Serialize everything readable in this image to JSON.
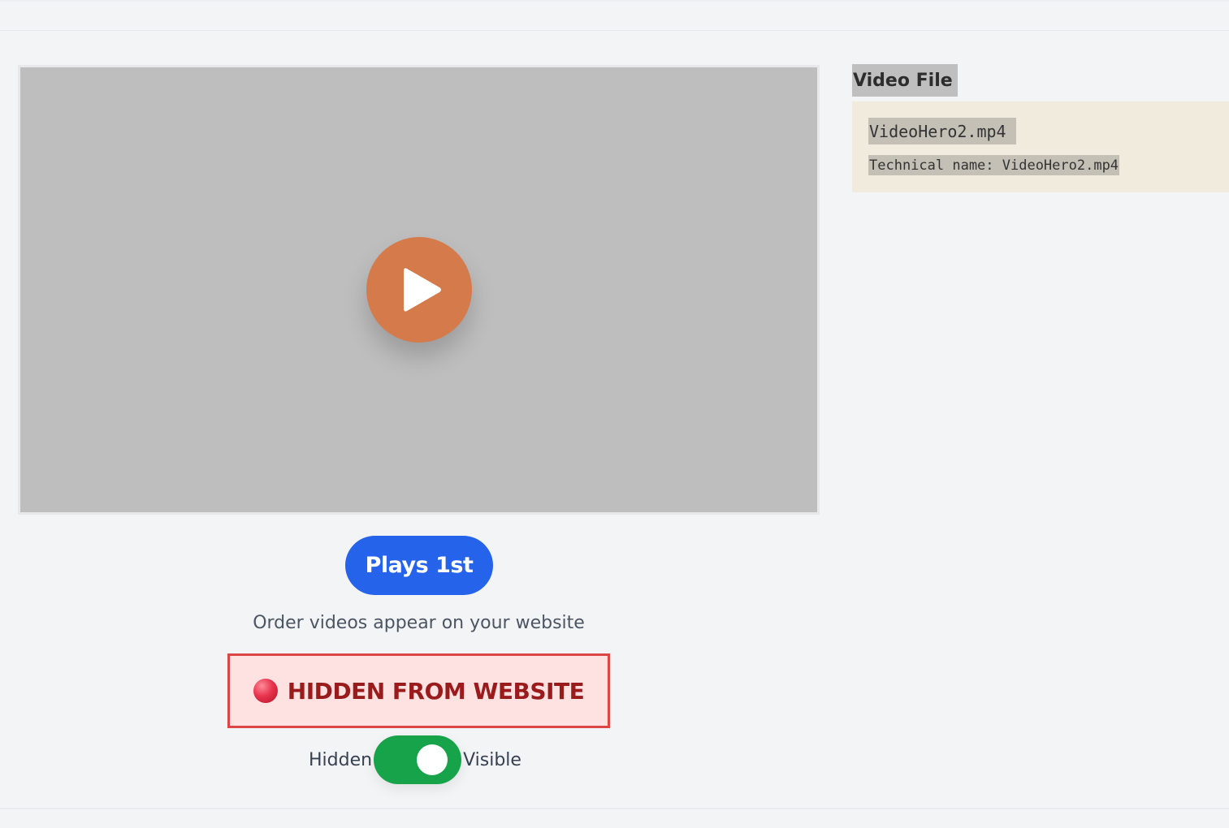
{
  "video": {
    "play_icon": "play-icon",
    "player_color": "#bebebf",
    "play_color": "#d57b4b"
  },
  "order": {
    "label": "Plays 1st",
    "caption": "Order videos appear on your website",
    "color": "#2563eb"
  },
  "status": {
    "label": "HIDDEN FROM WEBSITE",
    "icon": "red-dot-icon",
    "color": "#991b1b"
  },
  "visibility_toggle": {
    "left_label": "Hidden",
    "right_label": "Visible",
    "state": "on",
    "color": "#16a34a"
  },
  "file_panel": {
    "heading": "Video File",
    "file_name": "VideoHero2.mp4",
    "technical_name": "Technical name: VideoHero2.mp4"
  }
}
